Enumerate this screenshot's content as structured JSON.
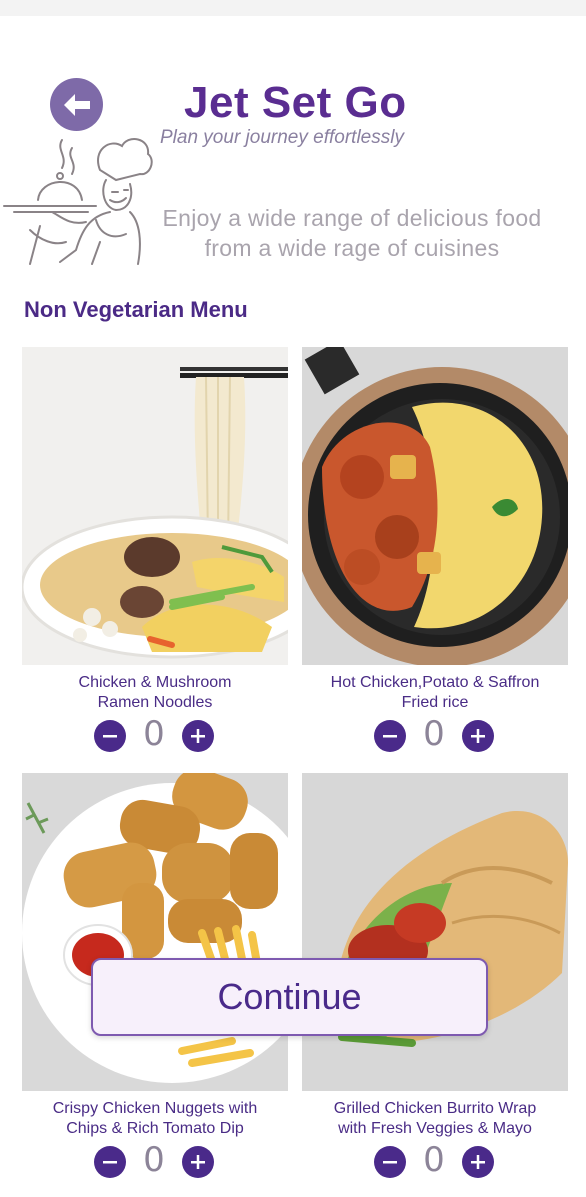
{
  "header": {
    "back_icon": "arrow-left-icon",
    "title": "Jet Set Go",
    "subtitle": "Plan your journey effortlessly",
    "tagline_line1": "Enjoy a wide range of delicious food",
    "tagline_line2": "from a wide rage of cuisines"
  },
  "section": {
    "title": "Non Vegetarian Menu"
  },
  "items": [
    {
      "name_line1": "Chicken & Mushroom",
      "name_line2": "Ramen Noodles",
      "qty": "0"
    },
    {
      "name_line1": "Hot Chicken,Potato & Saffron",
      "name_line2": "Fried rice",
      "qty": "0"
    },
    {
      "name_line1": "Crispy Chicken Nuggets with",
      "name_line2": "Chips & Rich Tomato Dip",
      "qty": "0"
    },
    {
      "name_line1": "Grilled Chicken Burrito Wrap",
      "name_line2": "with Fresh Veggies & Mayo",
      "qty": "0"
    }
  ],
  "actions": {
    "continue_label": "Continue"
  },
  "colors": {
    "primary": "#4a2a8a",
    "accent": "#7e6aa8",
    "muted": "#a9a4ad"
  }
}
